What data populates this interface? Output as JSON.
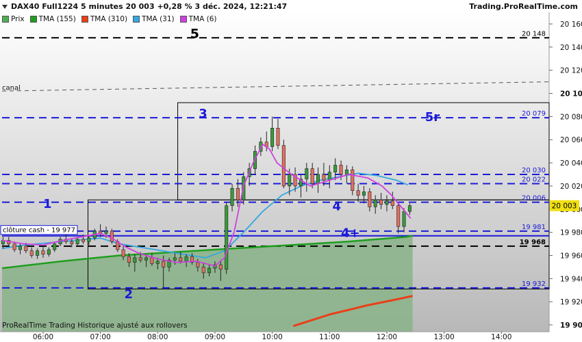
{
  "header": {
    "title": "DAX40 Full1224 5 minutes 20 003 +0,28 % 3 déc. 2024, 12:21:47",
    "brand": "Trading.ProRealTime.com"
  },
  "legend": [
    {
      "label": "Prix",
      "color": "#4caf50"
    },
    {
      "label": "TMA (155)",
      "color": "#1e9e1e"
    },
    {
      "label": "TMA (310)",
      "color": "#e8401a"
    },
    {
      "label": "TMA (31)",
      "color": "#35a7e0"
    },
    {
      "label": "TMA (6)",
      "color": "#d040e0"
    }
  ],
  "footer": "ProRealTime Trading Historique ajusté aux rollovers",
  "chart_data": {
    "type": "candlestick",
    "ylim": [
      19900,
      20160
    ],
    "y_ticks": [
      "20 160",
      "20 140",
      "20 120",
      "20 100",
      "20 080",
      "20 060",
      "20 040",
      "20 020",
      "20 000",
      "19 980",
      "19 960",
      "19 940",
      "19 920",
      "19 900"
    ],
    "y_ticks_bold": [
      "20 100",
      "19 900"
    ],
    "x_ticks": [
      "06:00",
      "07:00",
      "08:00",
      "09:00",
      "10:00",
      "11:00",
      "12:00",
      "13:00",
      "14:00"
    ],
    "x_tick_times": [
      360,
      420,
      480,
      540,
      600,
      660,
      720,
      780,
      840
    ],
    "xlim_time": [
      317,
      890
    ],
    "last_price": "20 003",
    "labels": {
      "cloture": "clôture cash -  19 977",
      "canal": "canal",
      "wave_1": "1",
      "wave_2": "2",
      "wave_3": "3",
      "wave_4": "4",
      "wave_4p": "4+",
      "wave_5": "5",
      "wave_5r": "5r"
    },
    "levels": [
      {
        "value": 20148,
        "label": "20 148",
        "color": "#000000"
      },
      {
        "value": 20079,
        "label": "20 079",
        "color": "#1a1ad8"
      },
      {
        "value": 20030,
        "label": "20 030",
        "color": "#1a1ad8"
      },
      {
        "value": 20022,
        "label": "20 022",
        "color": "#1a1ad8"
      },
      {
        "value": 20006,
        "label": "20 006",
        "color": "#1a1ad8"
      },
      {
        "value": 19981,
        "label": "19 981",
        "color": "#1a1ad8"
      },
      {
        "value": 19968,
        "label": "19 968",
        "color": "#000000"
      },
      {
        "value": 19932,
        "label": "19 932",
        "color": "#1a1ad8"
      }
    ],
    "cloture_value": 19977,
    "canal": {
      "t0": 317,
      "v0": 20102,
      "t1": 890,
      "v1": 20110
    },
    "boxes": [
      {
        "t0": 407,
        "t1": 890,
        "v0": 19931,
        "v1": 20008
      },
      {
        "t0": 501,
        "t1": 890,
        "v0": 20008,
        "v1": 20092
      }
    ],
    "area_tma155": [
      [
        317,
        19949
      ],
      [
        380,
        19955
      ],
      [
        440,
        19960
      ],
      [
        500,
        19963
      ],
      [
        560,
        19966
      ],
      [
        620,
        19969
      ],
      [
        680,
        19972
      ],
      [
        740,
        19976
      ],
      [
        747,
        19977
      ]
    ],
    "tma310": [
      [
        622,
        19899
      ],
      [
        660,
        19909
      ],
      [
        700,
        19917
      ],
      [
        730,
        19922
      ],
      [
        747,
        19925
      ]
    ],
    "tma31": [
      [
        317,
        19966
      ],
      [
        340,
        19969
      ],
      [
        380,
        19972
      ],
      [
        420,
        19975
      ],
      [
        440,
        19970
      ],
      [
        470,
        19966
      ],
      [
        500,
        19962
      ],
      [
        530,
        19958
      ],
      [
        550,
        19964
      ],
      [
        570,
        19980
      ],
      [
        590,
        19998
      ],
      [
        610,
        20012
      ],
      [
        630,
        20020
      ],
      [
        650,
        20025
      ],
      [
        670,
        20028
      ],
      [
        690,
        20031
      ],
      [
        710,
        20029
      ],
      [
        730,
        20025
      ],
      [
        742,
        20021
      ]
    ],
    "tma6": [
      [
        317,
        19973
      ],
      [
        340,
        19970
      ],
      [
        360,
        19969
      ],
      [
        380,
        19973
      ],
      [
        400,
        19976
      ],
      [
        420,
        19979
      ],
      [
        432,
        19975
      ],
      [
        445,
        19968
      ],
      [
        460,
        19962
      ],
      [
        480,
        19957
      ],
      [
        500,
        19954
      ],
      [
        520,
        19955
      ],
      [
        540,
        19951
      ],
      [
        550,
        19958
      ],
      [
        560,
        19980
      ],
      [
        570,
        20020
      ],
      [
        580,
        20040
      ],
      [
        590,
        20056
      ],
      [
        597,
        20052
      ],
      [
        605,
        20040
      ],
      [
        620,
        20030
      ],
      [
        640,
        20020
      ],
      [
        660,
        20025
      ],
      [
        680,
        20030
      ],
      [
        700,
        20027
      ],
      [
        715,
        20020
      ],
      [
        725,
        20012
      ],
      [
        735,
        20002
      ],
      [
        745,
        19992
      ]
    ],
    "candles": [
      {
        "t": 318,
        "o": 19970,
        "h": 19976,
        "l": 19966,
        "c": 19973
      },
      {
        "t": 324,
        "o": 19973,
        "h": 19976,
        "l": 19968,
        "c": 19970
      },
      {
        "t": 330,
        "o": 19970,
        "h": 19972,
        "l": 19963,
        "c": 19965
      },
      {
        "t": 336,
        "o": 19965,
        "h": 19970,
        "l": 19961,
        "c": 19968
      },
      {
        "t": 342,
        "o": 19968,
        "h": 19971,
        "l": 19962,
        "c": 19964
      },
      {
        "t": 348,
        "o": 19964,
        "h": 19967,
        "l": 19958,
        "c": 19960
      },
      {
        "t": 354,
        "o": 19960,
        "h": 19966,
        "l": 19957,
        "c": 19964
      },
      {
        "t": 360,
        "o": 19964,
        "h": 19968,
        "l": 19958,
        "c": 19961
      },
      {
        "t": 366,
        "o": 19961,
        "h": 19967,
        "l": 19959,
        "c": 19965
      },
      {
        "t": 372,
        "o": 19965,
        "h": 19972,
        "l": 19963,
        "c": 19970
      },
      {
        "t": 378,
        "o": 19970,
        "h": 19976,
        "l": 19968,
        "c": 19974
      },
      {
        "t": 384,
        "o": 19974,
        "h": 19978,
        "l": 19970,
        "c": 19972
      },
      {
        "t": 390,
        "o": 19972,
        "h": 19975,
        "l": 19967,
        "c": 19970
      },
      {
        "t": 396,
        "o": 19970,
        "h": 19976,
        "l": 19968,
        "c": 19974
      },
      {
        "t": 402,
        "o": 19974,
        "h": 19978,
        "l": 19970,
        "c": 19972
      },
      {
        "t": 408,
        "o": 19972,
        "h": 19977,
        "l": 19969,
        "c": 19975
      },
      {
        "t": 414,
        "o": 19975,
        "h": 19983,
        "l": 19973,
        "c": 19981
      },
      {
        "t": 420,
        "o": 19981,
        "h": 19987,
        "l": 19976,
        "c": 19979
      },
      {
        "t": 426,
        "o": 19979,
        "h": 19985,
        "l": 19975,
        "c": 19981
      },
      {
        "t": 432,
        "o": 19981,
        "h": 19983,
        "l": 19970,
        "c": 19972
      },
      {
        "t": 438,
        "o": 19972,
        "h": 19974,
        "l": 19963,
        "c": 19965
      },
      {
        "t": 444,
        "o": 19965,
        "h": 19968,
        "l": 19956,
        "c": 19959
      },
      {
        "t": 450,
        "o": 19959,
        "h": 19962,
        "l": 19950,
        "c": 19954
      },
      {
        "t": 456,
        "o": 19954,
        "h": 19961,
        "l": 19946,
        "c": 19958
      },
      {
        "t": 462,
        "o": 19958,
        "h": 19963,
        "l": 19954,
        "c": 19956
      },
      {
        "t": 468,
        "o": 19956,
        "h": 19960,
        "l": 19950,
        "c": 19958
      },
      {
        "t": 474,
        "o": 19958,
        "h": 19962,
        "l": 19951,
        "c": 19953
      },
      {
        "t": 480,
        "o": 19953,
        "h": 19958,
        "l": 19948,
        "c": 19955
      },
      {
        "t": 486,
        "o": 19955,
        "h": 19960,
        "l": 19932,
        "c": 19950
      },
      {
        "t": 492,
        "o": 19950,
        "h": 19958,
        "l": 19946,
        "c": 19956
      },
      {
        "t": 498,
        "o": 19956,
        "h": 19962,
        "l": 19952,
        "c": 19958
      },
      {
        "t": 504,
        "o": 19958,
        "h": 19963,
        "l": 19953,
        "c": 19955
      },
      {
        "t": 510,
        "o": 19955,
        "h": 19961,
        "l": 19950,
        "c": 19959
      },
      {
        "t": 516,
        "o": 19959,
        "h": 19962,
        "l": 19952,
        "c": 19954
      },
      {
        "t": 522,
        "o": 19954,
        "h": 19957,
        "l": 19946,
        "c": 19950
      },
      {
        "t": 528,
        "o": 19950,
        "h": 19954,
        "l": 19940,
        "c": 19945
      },
      {
        "t": 534,
        "o": 19945,
        "h": 19952,
        "l": 19942,
        "c": 19949
      },
      {
        "t": 540,
        "o": 19949,
        "h": 19955,
        "l": 19945,
        "c": 19952
      },
      {
        "t": 546,
        "o": 19952,
        "h": 19956,
        "l": 19938,
        "c": 19948
      },
      {
        "t": 552,
        "o": 19948,
        "h": 20006,
        "l": 19944,
        "c": 20003
      },
      {
        "t": 558,
        "o": 20003,
        "h": 20022,
        "l": 19998,
        "c": 20018
      },
      {
        "t": 564,
        "o": 20018,
        "h": 20026,
        "l": 20002,
        "c": 20008
      },
      {
        "t": 570,
        "o": 20008,
        "h": 20032,
        "l": 20004,
        "c": 20028
      },
      {
        "t": 576,
        "o": 20028,
        "h": 20040,
        "l": 20020,
        "c": 20035
      },
      {
        "t": 582,
        "o": 20035,
        "h": 20055,
        "l": 20030,
        "c": 20050
      },
      {
        "t": 588,
        "o": 20050,
        "h": 20062,
        "l": 20046,
        "c": 20058
      },
      {
        "t": 594,
        "o": 20058,
        "h": 20067,
        "l": 20050,
        "c": 20054
      },
      {
        "t": 600,
        "o": 20054,
        "h": 20080,
        "l": 20050,
        "c": 20070
      },
      {
        "t": 606,
        "o": 20070,
        "h": 20078,
        "l": 20052,
        "c": 20055
      },
      {
        "t": 612,
        "o": 20055,
        "h": 20060,
        "l": 20018,
        "c": 20020
      },
      {
        "t": 618,
        "o": 20020,
        "h": 20035,
        "l": 20012,
        "c": 20030
      },
      {
        "t": 624,
        "o": 20030,
        "h": 20036,
        "l": 20015,
        "c": 20020
      },
      {
        "t": 630,
        "o": 20020,
        "h": 20030,
        "l": 20010,
        "c": 20026
      },
      {
        "t": 636,
        "o": 20026,
        "h": 20040,
        "l": 20015,
        "c": 20035
      },
      {
        "t": 642,
        "o": 20035,
        "h": 20040,
        "l": 20018,
        "c": 20022
      },
      {
        "t": 648,
        "o": 20022,
        "h": 20036,
        "l": 20014,
        "c": 20030
      },
      {
        "t": 654,
        "o": 20030,
        "h": 20040,
        "l": 20020,
        "c": 20025
      },
      {
        "t": 660,
        "o": 20025,
        "h": 20038,
        "l": 20018,
        "c": 20032
      },
      {
        "t": 666,
        "o": 20032,
        "h": 20044,
        "l": 20025,
        "c": 20038
      },
      {
        "t": 672,
        "o": 20038,
        "h": 20042,
        "l": 20025,
        "c": 20030
      },
      {
        "t": 678,
        "o": 20030,
        "h": 20038,
        "l": 20022,
        "c": 20034
      },
      {
        "t": 684,
        "o": 20034,
        "h": 20037,
        "l": 20012,
        "c": 20016
      },
      {
        "t": 690,
        "o": 20016,
        "h": 20022,
        "l": 20006,
        "c": 20012
      },
      {
        "t": 696,
        "o": 20012,
        "h": 20020,
        "l": 20005,
        "c": 20015
      },
      {
        "t": 702,
        "o": 20015,
        "h": 20018,
        "l": 19998,
        "c": 20002
      },
      {
        "t": 708,
        "o": 20002,
        "h": 20012,
        "l": 19996,
        "c": 20008
      },
      {
        "t": 714,
        "o": 20008,
        "h": 20014,
        "l": 20000,
        "c": 20004
      },
      {
        "t": 720,
        "o": 20004,
        "h": 20012,
        "l": 19998,
        "c": 20007
      },
      {
        "t": 726,
        "o": 20007,
        "h": 20015,
        "l": 20000,
        "c": 20003
      },
      {
        "t": 732,
        "o": 20003,
        "h": 20006,
        "l": 19979,
        "c": 19985
      },
      {
        "t": 738,
        "o": 19985,
        "h": 20001,
        "l": 19980,
        "c": 19998
      },
      {
        "t": 744,
        "o": 19998,
        "h": 20005,
        "l": 19995,
        "c": 20003
      }
    ]
  }
}
